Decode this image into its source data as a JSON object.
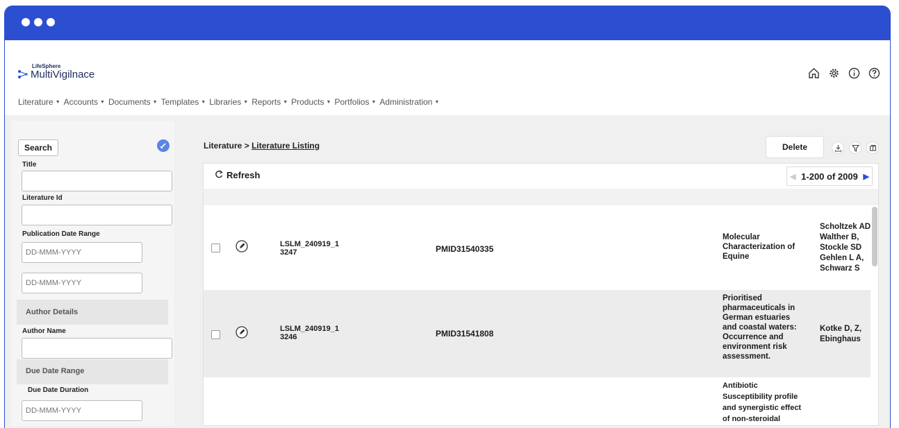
{
  "app": {
    "logo_small": "LifeSphere",
    "logo_big": "MultiVigilnace",
    "brand_color": "#2c4fd1"
  },
  "header_icons": [
    "home-icon",
    "gear-icon",
    "info-icon",
    "help-icon"
  ],
  "nav": [
    {
      "label": "Literature"
    },
    {
      "label": "Accounts"
    },
    {
      "label": "Documents"
    },
    {
      "label": "Templates"
    },
    {
      "label": "Libraries"
    },
    {
      "label": "Reports"
    },
    {
      "label": "Products"
    },
    {
      "label": "Portfolios"
    },
    {
      "label": "Administration"
    }
  ],
  "sidebar": {
    "search_label": "Search",
    "title_label": "Title",
    "title_value": "",
    "literature_id_label": "Literature Id",
    "literature_id_value": "",
    "pub_date_label": "Publication Date Range",
    "pub_date_from_placeholder": "DD-MMM-YYYY",
    "pub_date_to_placeholder": "DD-MMM-YYYY",
    "author_section": "Author Details",
    "author_name_label": "Author Name",
    "author_name_value": "",
    "due_section": "Due Date Range",
    "due_duration_label": "Due Date Duration",
    "due_date_placeholder": "DD-MMM-YYYY"
  },
  "main": {
    "breadcrumb_root": "Literature",
    "breadcrumb_sep": ">",
    "breadcrumb_current": "Literature Listing",
    "delete_label": "Delete",
    "refresh_label": "Refresh",
    "pager_text": "1-200 of 2009"
  },
  "rows": [
    {
      "lit_id_line1": "LSLM_240919_1",
      "lit_id_line2": "3247",
      "pmid": "PMID31540335",
      "title": "Molecular Characterization of Equine",
      "authors": "Scholtzek AD Walther B, Stockle SD Gehlen L A, Schwarz S"
    },
    {
      "lit_id_line1": "LSLM_240919_1",
      "lit_id_line2": "3246",
      "pmid": "PMID31541808",
      "title": "Prioritised pharmaceuticals in German estuaries and coastal waters: Occurrence and environment risk assessment.",
      "authors": "Kotke D, Z, Ebinghaus"
    },
    {
      "lit_id_line1": "",
      "lit_id_line2": "",
      "pmid": "",
      "title": "Antibiotic Susceptibility profile and synergistic effect of non-steroidal",
      "authors": ""
    }
  ]
}
